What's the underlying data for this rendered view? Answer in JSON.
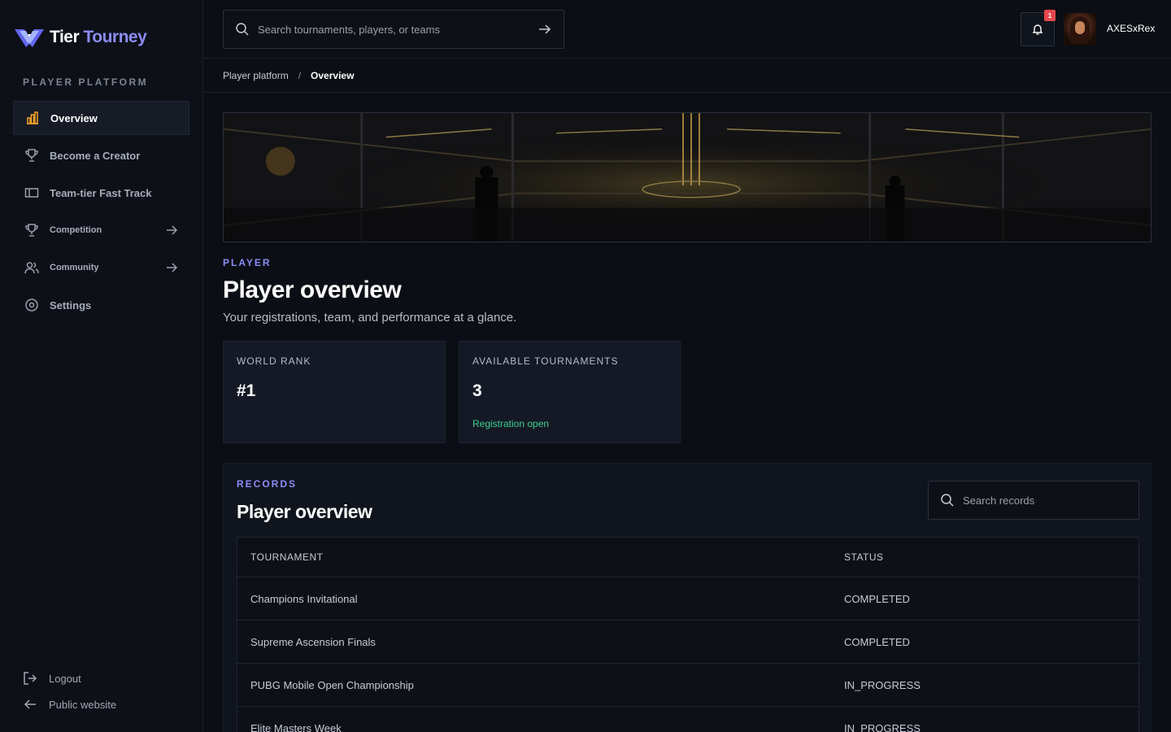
{
  "brand": {
    "name_part1": "Tier",
    "name_part2": "Tourney"
  },
  "sidebar": {
    "section_label": "PLAYER PLATFORM",
    "items": [
      {
        "label": "Overview",
        "icon": "bar-chart-icon",
        "active": true
      },
      {
        "label": "Become a Creator",
        "icon": "trophy-icon"
      },
      {
        "label": "Team-tier Fast Track",
        "icon": "ticket-icon"
      },
      {
        "label": "Competition",
        "icon": "trophy-icon",
        "has_arrow": true
      },
      {
        "label": "Community",
        "icon": "users-icon",
        "has_arrow": true
      },
      {
        "label": "Settings",
        "icon": "gear-icon"
      }
    ],
    "bottom": {
      "logout": "Logout",
      "public_site": "Public website"
    }
  },
  "topbar": {
    "search_placeholder": "Search tournaments, players, or teams",
    "notification_count": "1",
    "username": "AXESxRex"
  },
  "breadcrumb": {
    "parent": "Player platform",
    "separator": "/",
    "current": "Overview"
  },
  "header": {
    "kicker": "PLAYER",
    "title": "Player overview",
    "subtitle": "Your registrations, team, and performance at a glance."
  },
  "stats": [
    {
      "label": "WORLD RANK",
      "value": "#1",
      "note": ""
    },
    {
      "label": "AVAILABLE TOURNAMENTS",
      "value": "3",
      "note": "Registration open"
    }
  ],
  "records": {
    "kicker": "RECORDS",
    "title": "Player overview",
    "search_placeholder": "Search records",
    "columns": [
      "TOURNAMENT",
      "STATUS"
    ],
    "rows": [
      {
        "tournament": "Champions Invitational",
        "status": "COMPLETED"
      },
      {
        "tournament": "Supreme Ascension Finals",
        "status": "COMPLETED"
      },
      {
        "tournament": "PUBG Mobile Open Championship",
        "status": "IN_PROGRESS"
      },
      {
        "tournament": "Elite Masters Week",
        "status": "IN_PROGRESS"
      }
    ]
  },
  "colors": {
    "accent": "#8b8cf6",
    "success": "#3ecf8e",
    "badge": "#e5484d"
  }
}
